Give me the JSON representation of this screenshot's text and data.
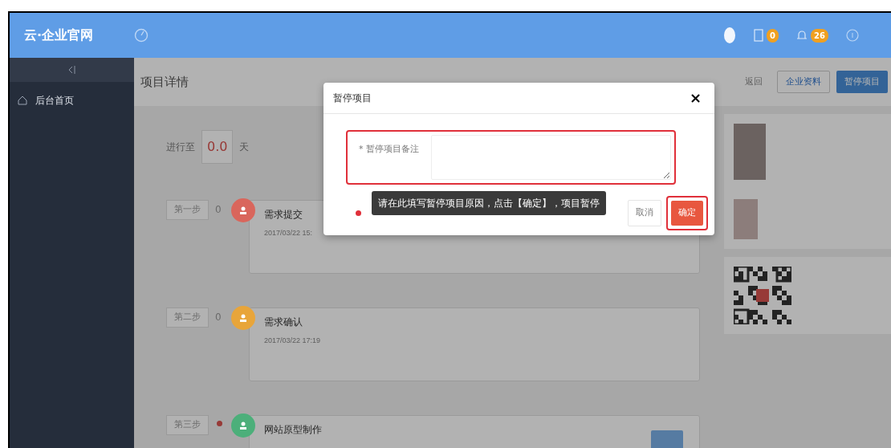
{
  "header": {
    "logo": "云·企业官网",
    "badges": [
      {
        "kind": "tasks",
        "count": "0"
      },
      {
        "kind": "bell",
        "count": "26"
      }
    ]
  },
  "sidebar": {
    "items": [
      {
        "label": "后台首页",
        "selected": false
      }
    ]
  },
  "page": {
    "title": "项目详情",
    "toolbar": [
      {
        "label": "返回",
        "kind": "link"
      },
      {
        "label": "企业资料",
        "kind": "outline"
      },
      {
        "label": "暂停项目",
        "kind": "primary"
      }
    ],
    "progress": {
      "label": "进行至",
      "value": "0.0",
      "unit": "天"
    },
    "steps": [
      {
        "step": "第一步",
        "kind": "count",
        "count": "0",
        "title": "需求提交",
        "time": "2017/03/22 15:",
        "color": "#d9665c",
        "action": false
      },
      {
        "step": "第二步",
        "kind": "count",
        "count": "0",
        "title": "需求确认",
        "time": "2017/03/22 17:19",
        "color": "#e8a53a",
        "action": false
      },
      {
        "step": "第三步",
        "kind": "dot",
        "title": "网站原型制作",
        "color": "#4caf7a",
        "action": true
      }
    ]
  },
  "modal": {
    "title": "暂停项目",
    "close": "×",
    "field_label": "* 暂停项目备注",
    "tooltip": "请在此填写暂停项目原因，点击【确定】，项目暂停",
    "buttons": [
      {
        "label": "取消",
        "kind": "default"
      },
      {
        "label": "确定",
        "kind": "danger"
      }
    ]
  }
}
